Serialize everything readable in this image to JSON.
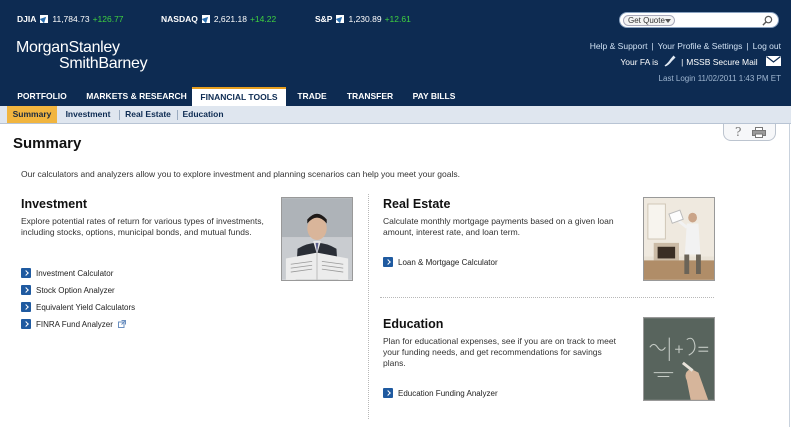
{
  "ticker": {
    "djia": {
      "name": "DJIA",
      "value": "11,784.73",
      "change": "+126.77"
    },
    "nasdaq": {
      "name": "NASDAQ",
      "value": "2,621.18",
      "change": "+14.22"
    },
    "sp": {
      "name": "S&P",
      "value": "1,230.89",
      "change": "+12.61"
    },
    "quote_select": "Get Quote"
  },
  "header": {
    "logo_line1": "MorganStanley",
    "logo_line2": "SmithBarney",
    "help_link": "Help & Support",
    "profile_link": "Your Profile & Settings",
    "logout_link": "Log out",
    "fa_label": "Your FA is",
    "mail_link": "MSSB Secure Mail",
    "last_login": "Last Login 11/02/2011 1:43 PM ET"
  },
  "nav": {
    "items": [
      "PORTFOLIO",
      "MARKETS & RESEARCH",
      "FINANCIAL TOOLS",
      "TRADE",
      "TRANSFER",
      "PAY BILLS"
    ]
  },
  "subnav": {
    "items": [
      "Summary",
      "Investment",
      "Real Estate",
      "Education"
    ]
  },
  "page": {
    "title": "Summary",
    "intro": "Our calculators and analyzers allow you to explore investment and planning scenarios can help you meet your goals."
  },
  "investment": {
    "title": "Investment",
    "desc": "Explore potential rates of return for various types of investments, including stocks, options, municipal bonds, and mutual funds.",
    "links": [
      "Investment Calculator",
      "Stock Option Analyzer",
      "Equivalent Yield Calculators",
      "FINRA Fund Analyzer"
    ]
  },
  "real_estate": {
    "title": "Real Estate",
    "desc": "Calculate monthly mortgage payments based on a given loan amount, interest rate, and loan term.",
    "links": [
      "Loan & Mortgage Calculator"
    ]
  },
  "education": {
    "title": "Education",
    "desc": "Plan for educational expenses, see if you are on track to meet your funding needs, and get recommendations for savings plans.",
    "links": [
      "Education Funding Analyzer"
    ]
  },
  "colors": {
    "navy": "#0d2b52",
    "accent_orange": "#f1b53f",
    "gain_green": "#3fd13f",
    "link_blue": "#1f5aa0"
  },
  "icons": [
    "up-arrow-icon",
    "search-icon",
    "phone-icon",
    "mail-icon",
    "help-icon",
    "print-icon",
    "chevron-right-icon",
    "external-link-icon"
  ]
}
